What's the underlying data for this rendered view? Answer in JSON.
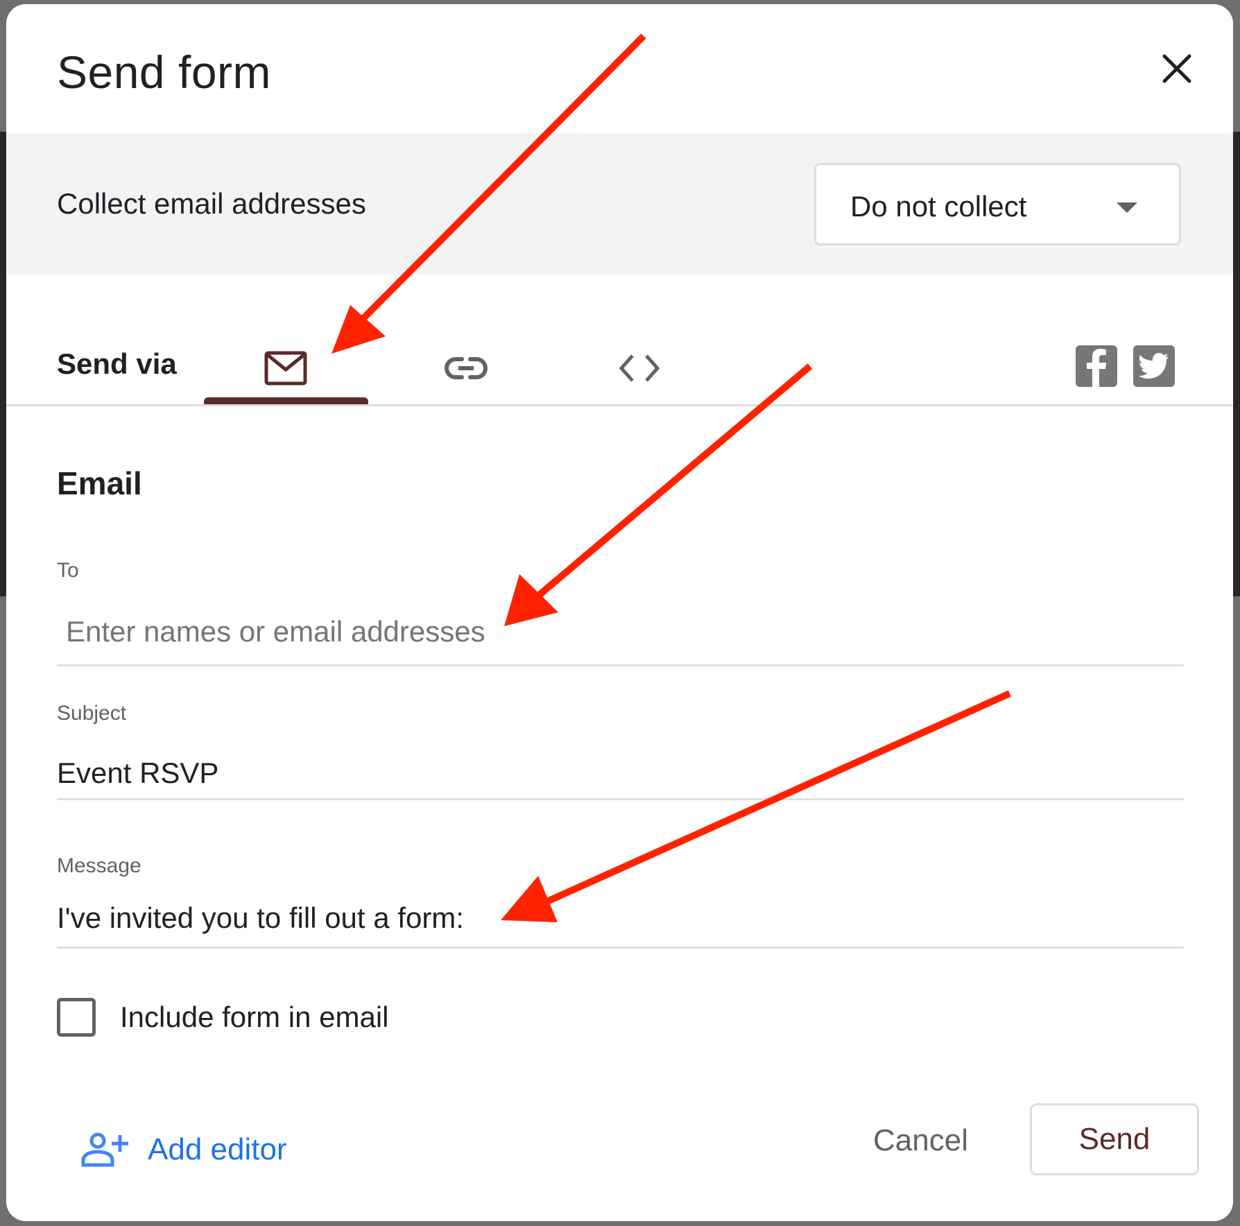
{
  "dialog": {
    "title": "Send form",
    "close_icon": "close-icon"
  },
  "collect_email": {
    "label": "Collect email addresses",
    "selected_option": "Do not collect"
  },
  "send_via": {
    "label": "Send via",
    "tabs": [
      {
        "name": "email",
        "icon": "mail-icon",
        "active": true
      },
      {
        "name": "link",
        "icon": "link-icon",
        "active": false
      },
      {
        "name": "embed",
        "icon": "code-icon",
        "active": false
      }
    ],
    "social": [
      {
        "name": "facebook",
        "icon": "facebook-icon"
      },
      {
        "name": "twitter",
        "icon": "twitter-icon"
      }
    ]
  },
  "email_section": {
    "heading": "Email",
    "to": {
      "label": "To",
      "value": "",
      "placeholder": "Enter names or email addresses"
    },
    "subject": {
      "label": "Subject",
      "value": "Event RSVP"
    },
    "message": {
      "label": "Message",
      "value": "I've invited you to fill out a form:"
    },
    "include_form": {
      "label": "Include form in email",
      "checked": false
    }
  },
  "footer": {
    "add_editor_label": "Add editor",
    "cancel_label": "Cancel",
    "send_label": "Send"
  },
  "colors": {
    "accent": "#5b2a2a",
    "link_blue": "#1a73e8",
    "annotation_red": "#ff2200",
    "band_gray": "#f1f3f4"
  }
}
